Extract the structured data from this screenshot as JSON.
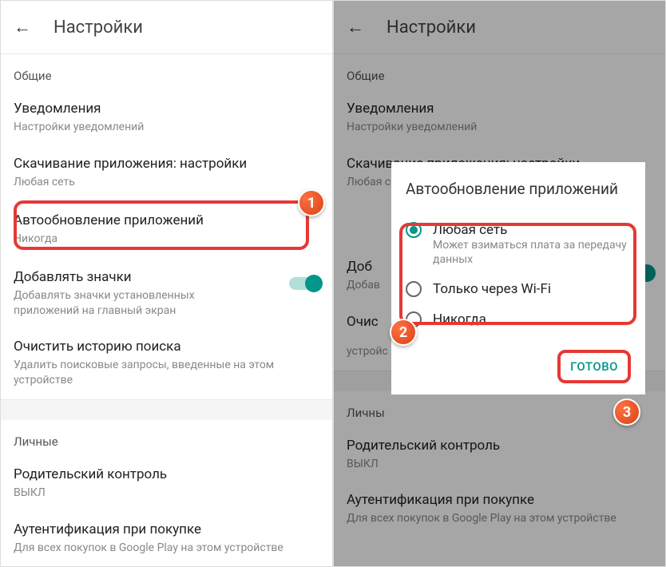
{
  "left": {
    "header": {
      "title": "Настройки"
    },
    "section_general": "Общие",
    "notifications": {
      "title": "Уведомления",
      "sub": "Настройки уведомлений"
    },
    "download": {
      "title": "Скачивание приложения: настройки",
      "sub": "Любая сеть"
    },
    "autoupdate": {
      "title": "Автообновление приложений",
      "sub": "Никогда"
    },
    "addicons": {
      "title": "Добавлять значки",
      "sub": "Добавлять значки установленных приложений на главный экран"
    },
    "clearhistory": {
      "title": "Очистить историю поиска",
      "sub": "Удалить поисковые запросы, введенные на этом устройстве"
    },
    "section_personal": "Личные",
    "parental": {
      "title": "Родительский контроль",
      "sub": "ВЫКЛ"
    },
    "auth": {
      "title": "Аутентификация при покупке",
      "sub": "Для всех покупок в Google Play на этом устройстве"
    }
  },
  "right": {
    "header": {
      "title": "Настройки"
    },
    "section_general": "Общие",
    "notifications": {
      "title": "Уведомления",
      "sub": "Настройки уведомлений"
    },
    "download": {
      "title": "Скачивание приложения: настройки",
      "sub": "Любая сеть"
    },
    "addicons_t": "Доб",
    "addicons_s": "Добав",
    "clearhistory_t": "Очис",
    "clearhistory_s": "устройс",
    "section_personal": "Личны",
    "parental": {
      "title": "Родительский контроль",
      "sub": "ВЫКЛ"
    },
    "auth": {
      "title": "Аутентификация при покупке",
      "sub": "Для всех покупок в Google Play на этом устройстве"
    },
    "dialog": {
      "title": "Автообновление приложений",
      "opt1_label": "Любая сеть",
      "opt1_sub": "Может взиматься плата за передачу данных",
      "opt2_label": "Только через Wi-Fi",
      "opt3_label": "Никогда",
      "done": "ГОТОВО"
    }
  },
  "badges": {
    "one": "1",
    "two": "2",
    "three": "3"
  }
}
